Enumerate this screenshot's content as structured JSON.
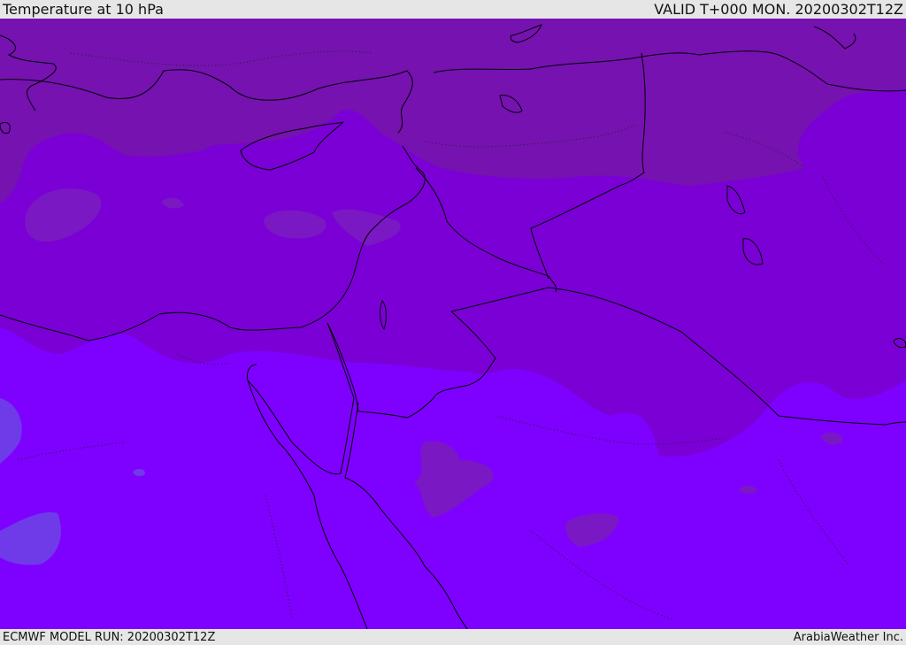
{
  "header": {
    "title": "Temperature at 10 hPa",
    "valid": "VALID T+000 MON. 20200302T12Z"
  },
  "footer": {
    "model_run": "ECMWF MODEL RUN: 20200302T12Z",
    "credit": "ArabiaWeather Inc."
  },
  "map": {
    "colors": {
      "band_north": "#7512b0",
      "band_mid": "#7a00d6",
      "band_south": "#7e00fe",
      "cold_patch": "#6f3ae8",
      "warm_patch": "#7a18c4",
      "coastline": "#000000"
    }
  }
}
